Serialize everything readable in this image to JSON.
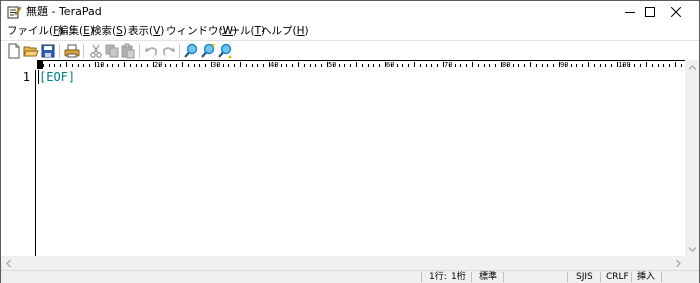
{
  "window": {
    "title": "無題 - TeraPad"
  },
  "menu": [
    {
      "label": "ファイル(",
      "key": "F",
      "tail": ")"
    },
    {
      "label": "編集(",
      "key": "E",
      "tail": ")"
    },
    {
      "label": "検索(",
      "key": "S",
      "tail": ")"
    },
    {
      "label": "表示(",
      "key": "V",
      "tail": ")"
    },
    {
      "label": "ウィンドウ(",
      "key": "W",
      "tail": ")"
    },
    {
      "label": "ツール(",
      "key": "T",
      "tail": ")"
    },
    {
      "label": "ヘルプ(",
      "key": "H",
      "tail": ")"
    }
  ],
  "toolbar": {
    "icons": [
      "new-file-icon",
      "open-folder-icon",
      "save-icon",
      "print-icon",
      "cut-icon",
      "copy-icon",
      "paste-icon",
      "undo-icon",
      "redo-icon",
      "find-icon",
      "find-previous-icon",
      "find-next-icon"
    ]
  },
  "ruler": {
    "labels": [
      "10",
      "20",
      "30",
      "40",
      "50",
      "60",
      "70",
      "80",
      "90",
      "100"
    ]
  },
  "editor": {
    "line_number": "1",
    "eof_marker": "[EOF]"
  },
  "status": {
    "line": "1行:",
    "column": "1桁",
    "mode": "標準",
    "encoding": "SJIS",
    "line_ending": "CRLF",
    "insert_mode": "挿入"
  },
  "colors": {
    "eof": "#008080",
    "chrome": "#f0f0f0",
    "find_icon": "#1a86c8"
  }
}
